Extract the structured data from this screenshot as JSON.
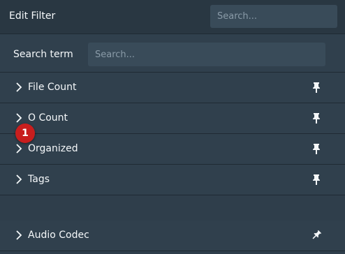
{
  "header": {
    "title": "Edit Filter",
    "search_placeholder": "Search..."
  },
  "search_term": {
    "label": "Search term",
    "placeholder": "Search..."
  },
  "criteria": [
    {
      "label": "File Count",
      "icon": "pin-icon"
    },
    {
      "label": "O Count",
      "icon": "pin-icon"
    },
    {
      "label": "Organized",
      "icon": "pin-icon"
    },
    {
      "label": "Tags",
      "icon": "pin-icon"
    }
  ],
  "other_criteria": [
    {
      "label": "Audio Codec",
      "icon": "pin-outline-icon"
    }
  ],
  "badge": {
    "count": "1"
  },
  "colors": {
    "background": "#30404d",
    "header": "#293742",
    "input": "#394b59",
    "badge": "#c81e1e"
  }
}
